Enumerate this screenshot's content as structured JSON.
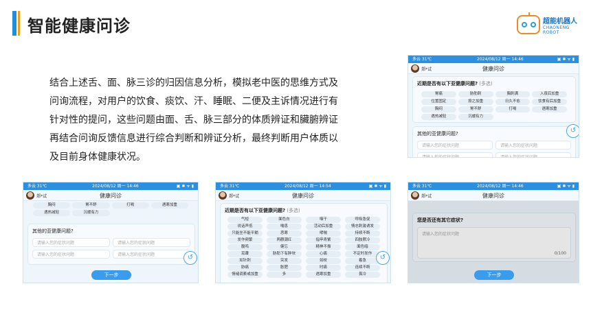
{
  "slide": {
    "title": "智能健康问诊",
    "logo_name": "超能机器人",
    "logo_sub": "CHAONENG ROBOT",
    "description": "结合上述舌、面、脉三诊的归因信息分析，模拟老中医的思维方式及问询流程，对用户的饮食、痰饮、汗、睡眠、二便及主诉情况进行有针对性的提问，这些问题由面、舌、脉三部分的体质辨证和臟腑辨证再结合问询反馈信息进行综合判断和辨证分析，最终判断用户体质以及目前身体健康状况。"
  },
  "common": {
    "weather": "多云 31℃",
    "datetime": "2024/08/12 周一",
    "time1": "14:46",
    "time3": "14:54",
    "status_icons": "▣ ✱ ᯤ ▮",
    "user": "郑*试",
    "nav_title": "健康问诊",
    "question": "近期是否有以下亚健康问题?",
    "multi": "(多选)",
    "other_title": "其他的亚健康问题?",
    "input_placeholder": "请输入您的症状问题",
    "next": "下一步",
    "back": "↺",
    "more_title": "您是否还有其它症状?",
    "more_placeholder": "请输入您的症状问题",
    "count": "0/100"
  },
  "screen1": {
    "tags": [
      "胃痛",
      "胁肋刺",
      "胸刺满",
      "入夜后加重",
      "位置固定",
      "按之加重",
      "日久不愈",
      "饮食有后加重",
      "胸闷",
      "胃不舒",
      "打嗝",
      "遇寒加重",
      "遇热减轻",
      "沉缓有力"
    ]
  },
  "screen2": {
    "tags": [
      "胸闷",
      "胃不舒",
      "打嗝",
      "遇寒加重",
      "遇热减轻",
      "沉缓有力"
    ]
  },
  "screen3": {
    "tags": [
      "气短",
      "面色白",
      "咽干",
      "呼吸急促",
      "说话声低",
      "喘息",
      "活动后加重",
      "情志刺激诱发",
      "只能坐不能平躺",
      "恶寒",
      "哮喘",
      "持续不断",
      "发作频繁",
      "两颧潮红",
      "指甲青紫",
      "四肢厥冷",
      "腹鸣",
      "健忘",
      "精神不振",
      "面色暗",
      "耳聋",
      "胁肋下有肿块",
      "心痛",
      "不定时发作",
      "如针刺",
      "突发",
      "如绞",
      "着急",
      "胁痛",
      "胀肥",
      "时痛",
      "连续不断",
      "情绪调紊或加重",
      "多",
      "遇寒加重",
      "畏冷"
    ]
  }
}
